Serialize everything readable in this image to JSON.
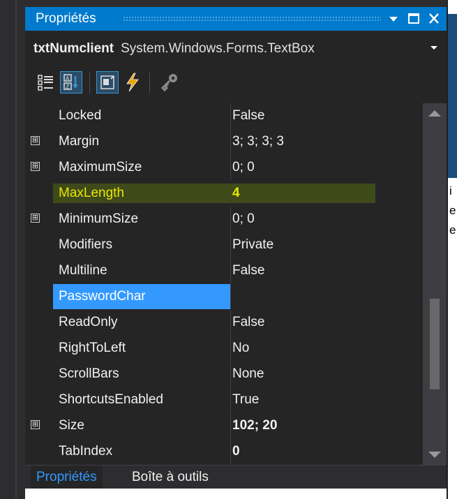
{
  "panel": {
    "title": "Propriétés",
    "object_name": "txtNumclient",
    "object_type": "System.Windows.Forms.TextBox"
  },
  "toolbar": {
    "buttons": [
      "categorized-icon",
      "alphabetical-icon",
      "properties-icon",
      "events-icon",
      "property-pages-icon"
    ]
  },
  "properties": [
    {
      "name": "Locked",
      "value": "False",
      "expandable": false
    },
    {
      "name": "Margin",
      "value": "3; 3; 3; 3",
      "expandable": true
    },
    {
      "name": "MaximumSize",
      "value": "0; 0",
      "expandable": true
    },
    {
      "name": "MaxLength",
      "value": "4",
      "expandable": false,
      "highlighted": true
    },
    {
      "name": "MinimumSize",
      "value": "0; 0",
      "expandable": true
    },
    {
      "name": "Modifiers",
      "value": "Private",
      "expandable": false
    },
    {
      "name": "Multiline",
      "value": "False",
      "expandable": false
    },
    {
      "name": "PasswordChar",
      "value": "",
      "expandable": false,
      "selected": true
    },
    {
      "name": "ReadOnly",
      "value": "False",
      "expandable": false
    },
    {
      "name": "RightToLeft",
      "value": "No",
      "expandable": false
    },
    {
      "name": "ScrollBars",
      "value": "None",
      "expandable": false
    },
    {
      "name": "ShortcutsEnabled",
      "value": "True",
      "expandable": false
    },
    {
      "name": "Size",
      "value": "102; 20",
      "expandable": true,
      "bold": true
    },
    {
      "name": "TabIndex",
      "value": "0",
      "expandable": false,
      "bold": true
    }
  ],
  "expander_glyph": "⊞",
  "bottom_tabs": {
    "properties_label": "Propriétés",
    "toolbox_label": "Boîte à outils"
  },
  "background_chars": [
    "i",
    "e",
    "e"
  ],
  "colors": {
    "accent": "#007acc",
    "selection": "#3399ff",
    "highlight_text": "#e8e800",
    "panel_bg": "#252526"
  }
}
